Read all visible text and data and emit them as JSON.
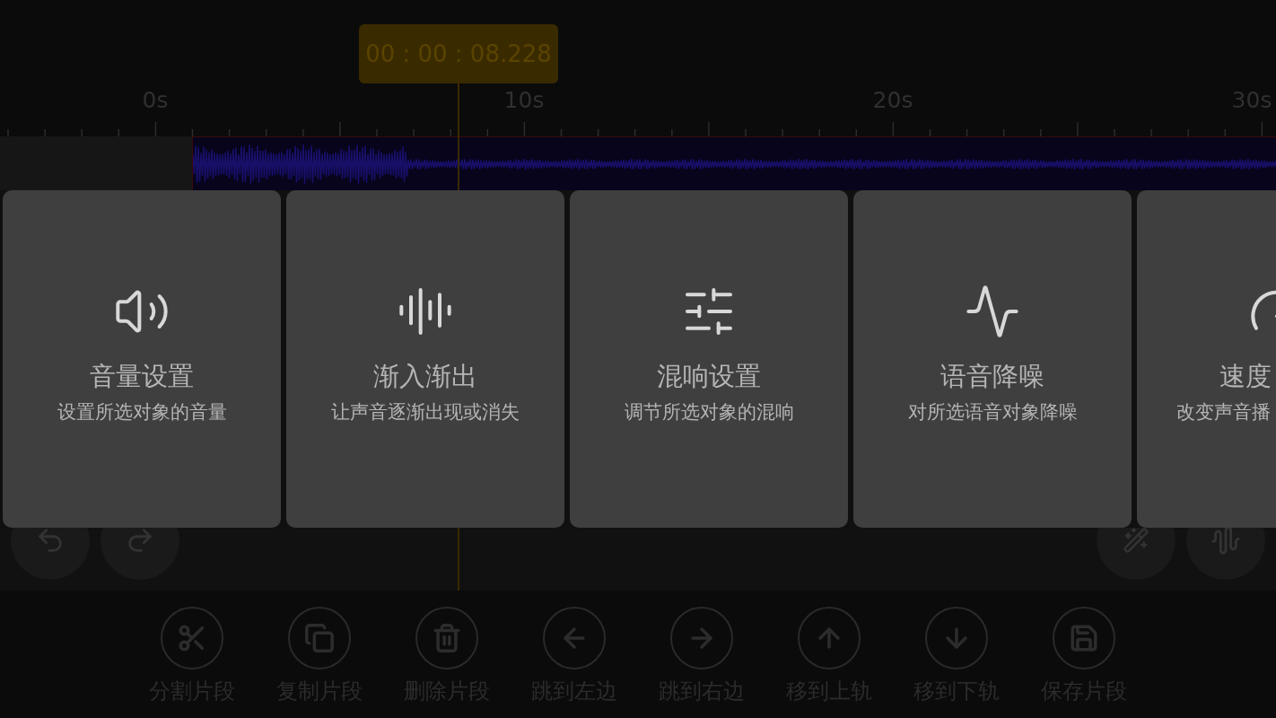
{
  "timecode": "00 : 00 : 08.228",
  "ruler": [
    "0s",
    "10s",
    "20s",
    "30s"
  ],
  "cards": [
    {
      "kind": "speaker",
      "title": "音量设置",
      "subtitle": "设置所选对象的音量"
    },
    {
      "kind": "bars",
      "title": "渐入渐出",
      "subtitle": "让声音逐渐出现或消失"
    },
    {
      "kind": "sliders",
      "title": "混响设置",
      "subtitle": "调节所选对象的混响"
    },
    {
      "kind": "pulse",
      "title": "语音降噪",
      "subtitle": "对所选语音对象降噪"
    },
    {
      "kind": "gauge",
      "title": "速度",
      "subtitle": "改变声音播"
    }
  ],
  "toolbar": [
    {
      "kind": "scissors",
      "label": "分割片段"
    },
    {
      "kind": "copy",
      "label": "复制片段"
    },
    {
      "kind": "trash",
      "label": "删除片段"
    },
    {
      "kind": "left",
      "label": "跳到左边"
    },
    {
      "kind": "right",
      "label": "跳到右边"
    },
    {
      "kind": "up",
      "label": "移到上轨"
    },
    {
      "kind": "down",
      "label": "移到下轨"
    },
    {
      "kind": "save",
      "label": "保存片段"
    }
  ]
}
